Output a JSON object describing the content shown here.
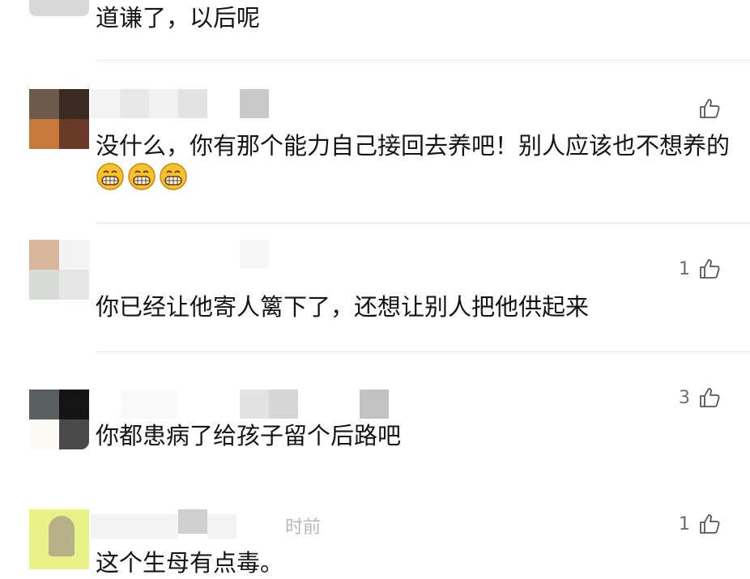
{
  "comments": [
    {
      "text": "道谦了，以后呢"
    },
    {
      "text": "没什么，你有那个能力自己接回去养吧！别人应该也不想养的",
      "likes": "",
      "emoji": [
        "grin-emoji",
        "grin-emoji",
        "grin-emoji"
      ]
    },
    {
      "text": "你已经让他寄人篱下了，还想让别人把他供起来",
      "likes": "1"
    },
    {
      "text": "你都患病了给孩子留个后路吧",
      "likes": "3"
    },
    {
      "text": "这个生母有点毒。",
      "likes": "1",
      "time_partial": "时前"
    }
  ],
  "icons": {
    "like": "thumbs-up-outline-icon",
    "emoji": "grinning-face-emoji"
  },
  "colors": {
    "divider": "#e6e6e6",
    "meta": "#6d6d6d",
    "text": "#141414"
  }
}
